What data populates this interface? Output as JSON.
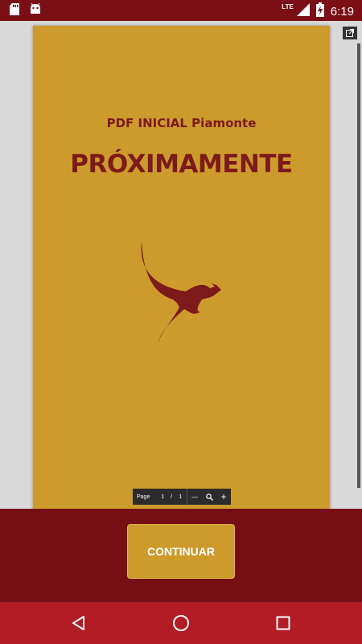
{
  "status_bar": {
    "time": "6:19",
    "network": "LTE",
    "icons": [
      "sd-card-icon",
      "android-debug-icon",
      "signal-icon",
      "battery-charging-icon"
    ]
  },
  "pdf": {
    "subtitle": "PDF INICIAL Piamonte",
    "title": "PRÓXIMAMENTE",
    "logo": "kangaroo-logo",
    "accent_color": "#cd9b2c",
    "text_color": "#7d1a1a"
  },
  "pdf_toolbar": {
    "page_label": "Page",
    "current_page": "1",
    "separator": "/",
    "total_pages": "1",
    "zoom_out": "—",
    "zoom_icon": "🔍",
    "zoom_in": "+"
  },
  "actions": {
    "continue_label": "CONTINUAR",
    "background": "#760f15"
  },
  "nav_bar": {
    "buttons": [
      "back-icon",
      "home-icon",
      "recents-icon"
    ],
    "background": "#b11c25"
  }
}
